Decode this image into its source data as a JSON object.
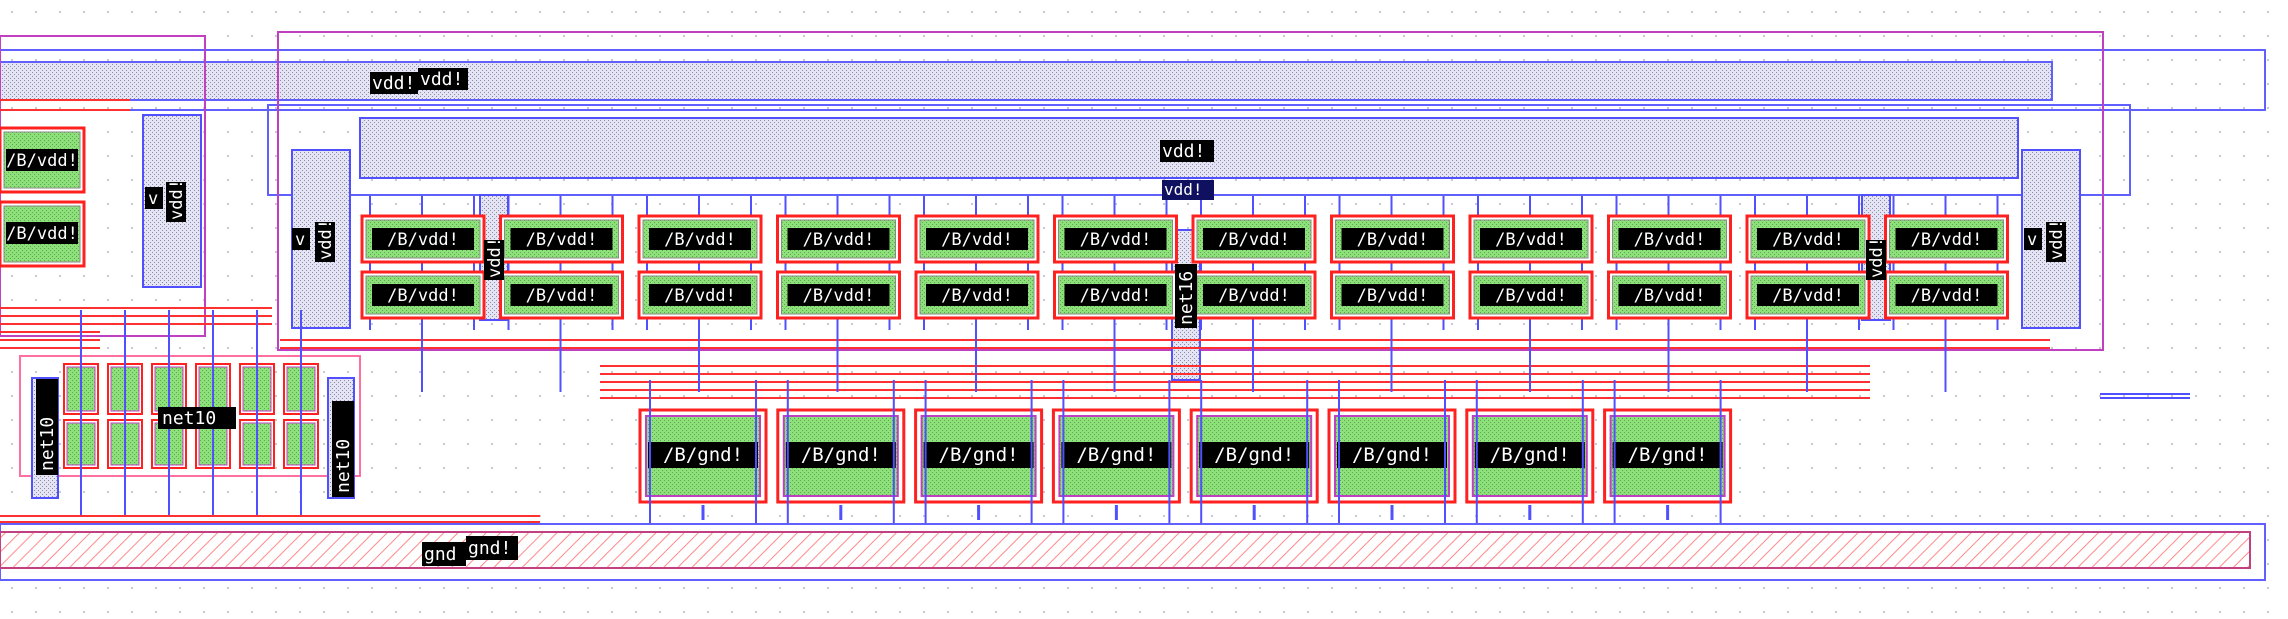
{
  "layout_editor": {
    "colors": {
      "background": "#ffffff",
      "grid_dot": "#c8c8d8",
      "metal1_line": "#ff3030",
      "metal2_line": "#5050ff",
      "cell_outline": "#c040c0",
      "nwell": "#7070ff",
      "device_fill": "#88e070",
      "device_border": "#ff2020",
      "label_bg": "#000000",
      "label_fg": "#ffffff",
      "label_bg_alt": "#101060"
    },
    "labels": {
      "vdd_main": "vdd!",
      "vdd_main_dup": "vdd!",
      "vdd_rail_center": "vdd!",
      "vdd_small": "vdd!",
      "vdd_vertical": "vdd!",
      "v_char": "v",
      "net16": "net16",
      "net10": "net10",
      "gnd_a": "gnd",
      "gnd_b": "gnd!"
    },
    "pmos_label": "/B/vdd!",
    "nmos_label": "/B/gnd!",
    "pmos_top_count": 12,
    "pmos_bottom_count": 12,
    "nmos_count": 8,
    "left_pmos_labels": [
      "/B/vdd!",
      "/B/vdd!"
    ]
  }
}
